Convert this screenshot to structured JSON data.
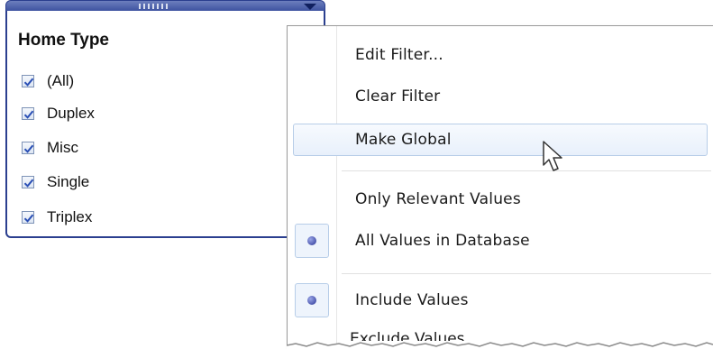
{
  "filter_panel": {
    "title": "Home Type",
    "items": [
      {
        "label": "(All)",
        "checked": true
      },
      {
        "label": "Duplex",
        "checked": true
      },
      {
        "label": "Misc",
        "checked": true
      },
      {
        "label": "Single",
        "checked": true
      },
      {
        "label": "Triplex",
        "checked": true
      }
    ]
  },
  "context_menu": {
    "edit_filter": "Edit Filter...",
    "clear_filter": "Clear Filter",
    "make_global": "Make Global",
    "only_relevant_values": "Only Relevant Values",
    "all_values_in_database": "All Values in Database",
    "include_values": "Include Values",
    "exclude_values": "Exclude Values",
    "highlighted_item": "Make Global",
    "selected_value_scope": "All Values in Database",
    "selected_value_mode": "Include Values"
  },
  "colors": {
    "panel_border": "#2b3f8f",
    "highlight_border": "#b7cde8",
    "radio_dot": "#2a3596",
    "checkmark": "#2a4fb5"
  },
  "icons": {
    "dropdown": "chevron-down-icon",
    "check": "checkmark-icon",
    "radio": "radio-dot-icon",
    "cursor": "mouse-pointer-icon"
  }
}
